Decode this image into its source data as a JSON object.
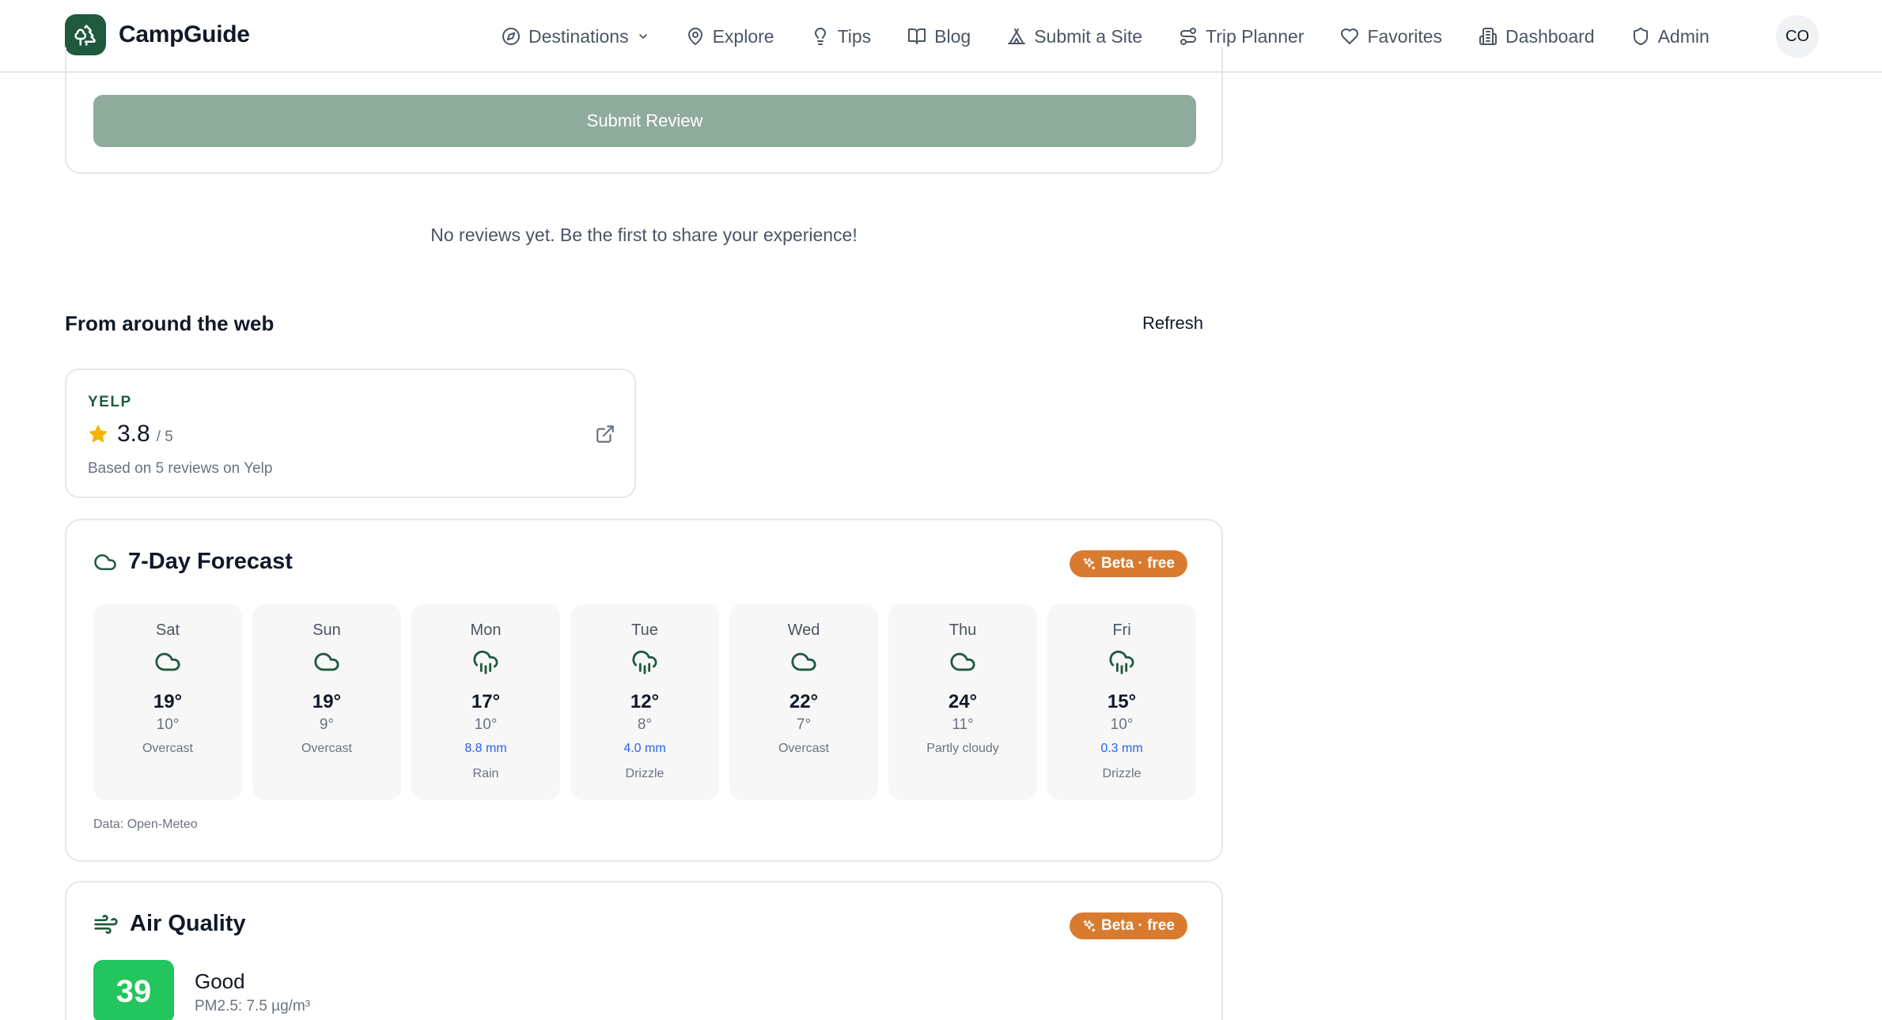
{
  "brand": {
    "name": "CampGuide"
  },
  "nav": {
    "items": [
      {
        "label": "Destinations",
        "icon": "compass-icon"
      },
      {
        "label": "Explore",
        "icon": "map-pin-icon"
      },
      {
        "label": "Tips",
        "icon": "lightbulb-icon"
      },
      {
        "label": "Blog",
        "icon": "book-open-icon"
      },
      {
        "label": "Submit a Site",
        "icon": "tent-icon"
      },
      {
        "label": "Trip Planner",
        "icon": "route-icon"
      },
      {
        "label": "Favorites",
        "icon": "heart-icon"
      },
      {
        "label": "Dashboard",
        "icon": "building-icon"
      },
      {
        "label": "Admin",
        "icon": "shield-icon"
      }
    ],
    "avatar": "CO"
  },
  "review_form": {
    "submit_label": "Submit Review"
  },
  "reviews": {
    "empty_text": "No reviews yet. Be the first to share your experience!"
  },
  "web": {
    "title": "From around the web",
    "refresh_label": "Refresh",
    "yelp": {
      "source": "YELP",
      "score": "3.8",
      "max": "/ 5",
      "basis": "Based on 5 reviews on Yelp"
    }
  },
  "forecast": {
    "title": "7-Day Forecast",
    "badge": "Beta · free",
    "source": "Data: Open-Meteo",
    "days": [
      {
        "name": "Sat",
        "high": "19°",
        "low": "10°",
        "precip": "",
        "condition": "Overcast",
        "icon": "cloud-icon"
      },
      {
        "name": "Sun",
        "high": "19°",
        "low": "9°",
        "precip": "",
        "condition": "Overcast",
        "icon": "cloud-icon"
      },
      {
        "name": "Mon",
        "high": "17°",
        "low": "10°",
        "precip": "8.8 mm",
        "condition": "Rain",
        "icon": "cloud-rain-icon"
      },
      {
        "name": "Tue",
        "high": "12°",
        "low": "8°",
        "precip": "4.0 mm",
        "condition": "Drizzle",
        "icon": "cloud-rain-icon"
      },
      {
        "name": "Wed",
        "high": "22°",
        "low": "7°",
        "precip": "",
        "condition": "Overcast",
        "icon": "cloud-icon"
      },
      {
        "name": "Thu",
        "high": "24°",
        "low": "11°",
        "precip": "",
        "condition": "Partly cloudy",
        "icon": "cloud-icon"
      },
      {
        "name": "Fri",
        "high": "15°",
        "low": "10°",
        "precip": "0.3 mm",
        "condition": "Drizzle",
        "icon": "cloud-rain-icon"
      }
    ]
  },
  "air_quality": {
    "title": "Air Quality",
    "badge": "Beta · free",
    "aqi": "39",
    "level": "Good",
    "pm25": "PM2.5: 7.5 µg/m³"
  },
  "colors": {
    "brand": "#1f5a3e",
    "badge": "#d97b2f",
    "aqi_good": "#22c55e",
    "precip": "#2563eb",
    "submit_disabled": "#8fab9c"
  }
}
